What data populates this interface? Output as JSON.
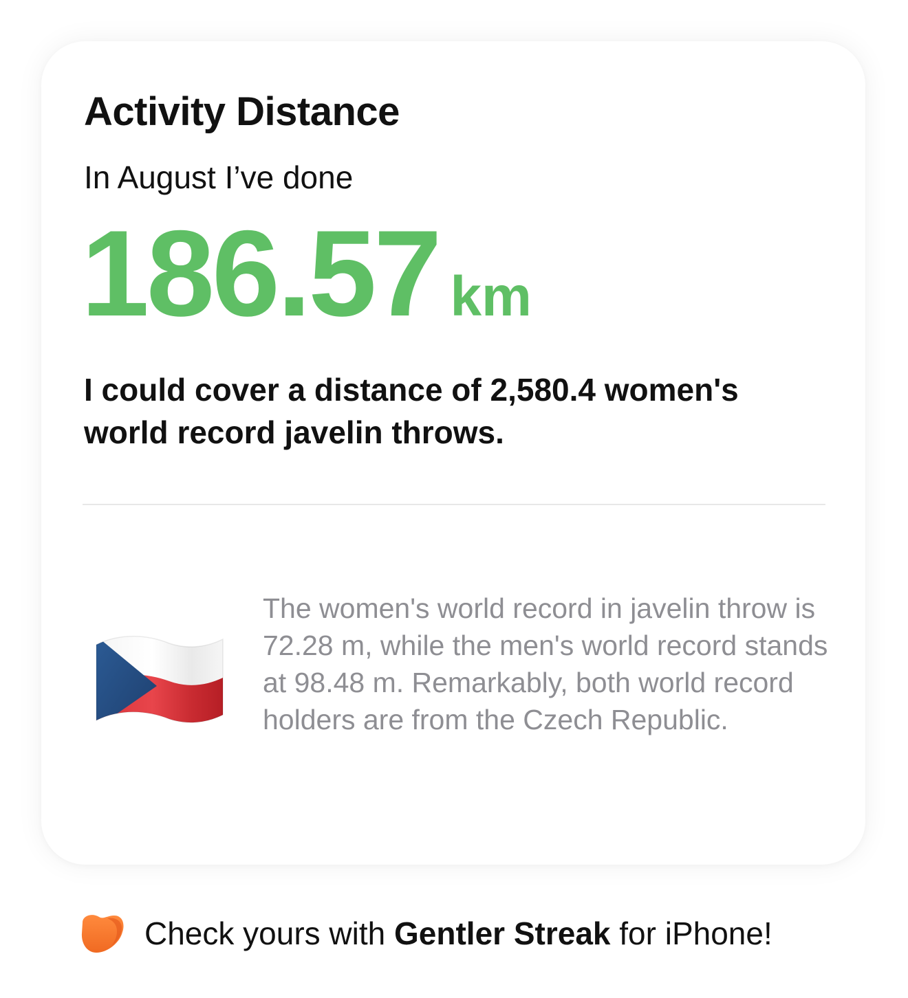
{
  "card": {
    "title": "Activity Distance",
    "subtitle": "In August I’ve done",
    "distance_value": "186.57",
    "distance_unit": "km",
    "comparison": "I could cover a distance of 2,580.4 women's world record javelin throws.",
    "fact": "The women's world record in javelin throw is 72.28 m, while the men's world record stands at 98.48 m. Remarkably, both world record holders are from the Czech Republic.",
    "flag_icon": "czech-flag-icon"
  },
  "footer": {
    "icon": "gentler-streak-heart-icon",
    "prefix": "Check yours with ",
    "app_name": "Gentler Streak",
    "suffix": " for iPhone!"
  },
  "colors": {
    "accent_green": "#5fbf65",
    "brand_orange": "#f57a32",
    "muted_text": "#8e8e93"
  }
}
